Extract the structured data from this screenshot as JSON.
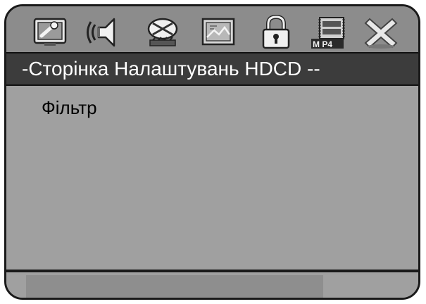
{
  "title": "-Сторінка Налаштувань HDCD --",
  "toolbar": {
    "icons": [
      {
        "name": "general-setup-icon"
      },
      {
        "name": "audio-setup-icon"
      },
      {
        "name": "dolby-setup-icon"
      },
      {
        "name": "video-setup-icon"
      },
      {
        "name": "lock-icon"
      },
      {
        "name": "mp4-icon"
      },
      {
        "name": "exit-icon"
      }
    ]
  },
  "menu": {
    "items": [
      {
        "label": "Фільтр"
      }
    ]
  },
  "status": {
    "text": ""
  },
  "colors": {
    "panel": "#a0a0a0",
    "toolbar": "#8c8c8c",
    "title_bar": "#3c3c3c",
    "title_text": "#ffffff",
    "border": "#1a1a1a"
  }
}
